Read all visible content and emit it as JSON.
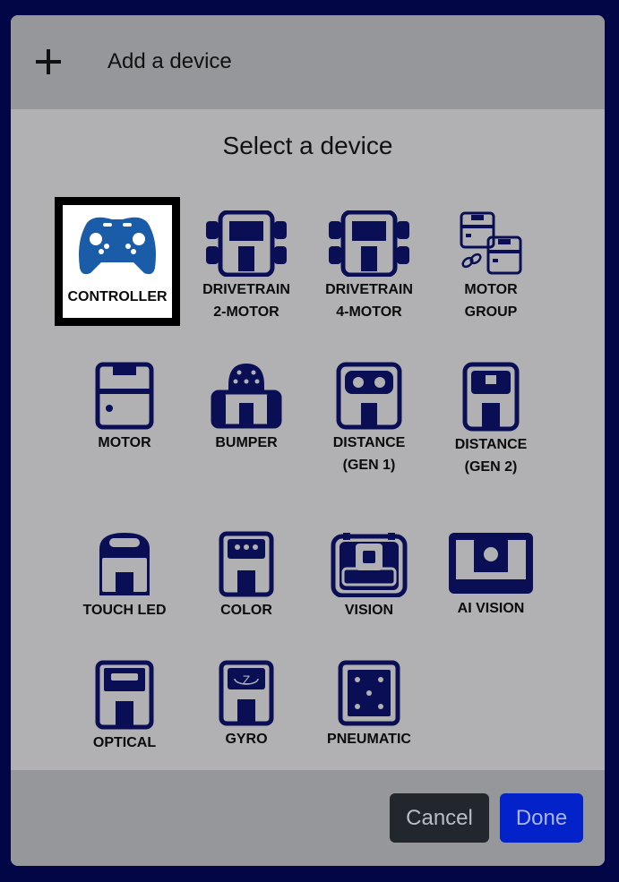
{
  "header": {
    "title": "Add a device",
    "icon": "plus-icon"
  },
  "body": {
    "title": "Select a device"
  },
  "devices": [
    {
      "label": "CONTROLLER",
      "icon": "controller-icon",
      "selected": true
    },
    {
      "label": "DRIVETRAIN\n2-MOTOR",
      "icon": "drivetrain-2-motor-icon"
    },
    {
      "label": "DRIVETRAIN\n4-MOTOR",
      "icon": "drivetrain-4-motor-icon"
    },
    {
      "label": "MOTOR\nGROUP",
      "icon": "motor-group-icon"
    },
    {
      "label": "MOTOR",
      "icon": "motor-icon"
    },
    {
      "label": "BUMPER",
      "icon": "bumper-icon"
    },
    {
      "label": "DISTANCE\n(GEN 1)",
      "icon": "distance-gen1-icon"
    },
    {
      "label": "DISTANCE\n(GEN 2)",
      "icon": "distance-gen2-icon"
    },
    {
      "label": "TOUCH LED",
      "icon": "touch-led-icon"
    },
    {
      "label": "COLOR",
      "icon": "color-sensor-icon"
    },
    {
      "label": "VISION",
      "icon": "vision-sensor-icon"
    },
    {
      "label": "AI VISION",
      "icon": "ai-vision-icon"
    },
    {
      "label": "OPTICAL",
      "icon": "optical-sensor-icon"
    },
    {
      "label": "GYRO",
      "icon": "gyro-icon"
    },
    {
      "label": "PNEUMATIC",
      "icon": "pneumatic-icon"
    }
  ],
  "footer": {
    "cancel_label": "Cancel",
    "done_label": "Done"
  },
  "colors": {
    "icon": "#0a0f55",
    "controller": "#1a5ca8",
    "done": "#0422c9",
    "cancel": "#22262d"
  }
}
